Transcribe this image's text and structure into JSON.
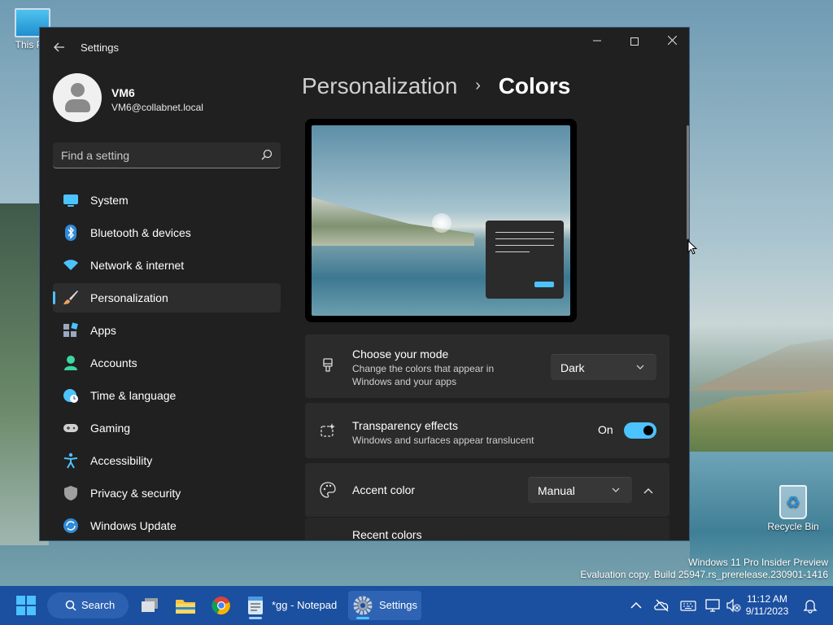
{
  "desktop": {
    "this_pc_label": "This PC",
    "recycle_bin_label": "Recycle Bin",
    "watermark_line1": "Windows 11 Pro Insider Preview",
    "watermark_line2": "Evaluation copy. Build 25947.rs_prerelease.230901-1416"
  },
  "window": {
    "title": "Settings",
    "minimize_icon": "minimize-icon",
    "maximize_icon": "maximize-icon",
    "close_icon": "close-icon"
  },
  "profile": {
    "name": "VM6",
    "email": "VM6@collabnet.local"
  },
  "search": {
    "placeholder": "Find a setting"
  },
  "nav": {
    "items": [
      {
        "label": "System",
        "icon": "monitor-icon",
        "color": "#4cc2ff"
      },
      {
        "label": "Bluetooth & devices",
        "icon": "bluetooth-icon",
        "color": "#4cc2ff"
      },
      {
        "label": "Network & internet",
        "icon": "wifi-icon",
        "color": "#4cc2ff"
      },
      {
        "label": "Personalization",
        "icon": "brush-icon",
        "color": "#f0a060"
      },
      {
        "label": "Apps",
        "icon": "apps-icon",
        "color": "#9aa8c0"
      },
      {
        "label": "Accounts",
        "icon": "person-icon",
        "color": "#3dd6a0"
      },
      {
        "label": "Time & language",
        "icon": "globe-clock-icon",
        "color": "#4cc2ff"
      },
      {
        "label": "Gaming",
        "icon": "gamepad-icon",
        "color": "#cfcfcf"
      },
      {
        "label": "Accessibility",
        "icon": "accessibility-icon",
        "color": "#4cc2ff"
      },
      {
        "label": "Privacy & security",
        "icon": "shield-icon",
        "color": "#a0a0a0"
      },
      {
        "label": "Windows Update",
        "icon": "update-icon",
        "color": "#4cc2ff"
      }
    ],
    "active_index": 3
  },
  "breadcrumb": {
    "parent": "Personalization",
    "separator": "›",
    "current": "Colors"
  },
  "mode_card": {
    "title": "Choose your mode",
    "description": "Change the colors that appear in Windows and your apps",
    "value": "Dark"
  },
  "transparency_card": {
    "title": "Transparency effects",
    "description": "Windows and surfaces appear translucent",
    "toggle_label": "On",
    "toggle_on": true
  },
  "accent_card": {
    "title": "Accent color",
    "value": "Manual"
  },
  "recent_colors": {
    "title": "Recent colors"
  },
  "taskbar": {
    "search_label": "Search",
    "apps": [
      {
        "label": "",
        "icon": "task-view-icon"
      },
      {
        "label": "",
        "icon": "file-explorer-icon"
      },
      {
        "label": "",
        "icon": "chrome-icon"
      },
      {
        "label": "*gg - Notepad",
        "icon": "notepad-icon"
      },
      {
        "label": "Settings",
        "icon": "settings-gear-icon"
      }
    ],
    "clock_time": "11:12 AM",
    "clock_date": "9/11/2023",
    "accent": "#4cc2ff"
  }
}
